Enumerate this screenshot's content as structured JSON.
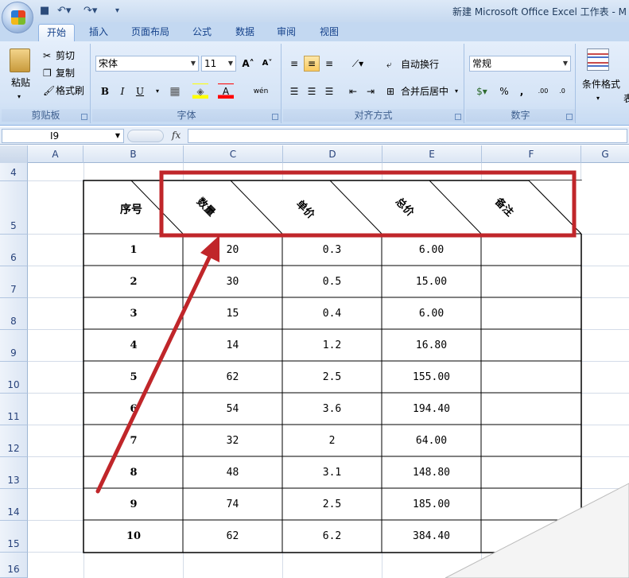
{
  "window": {
    "title": "新建 Microsoft Office Excel 工作表 - M"
  },
  "ribbon_tabs": [
    "开始",
    "插入",
    "页面布局",
    "公式",
    "数据",
    "审阅",
    "视图"
  ],
  "clipboard": {
    "paste": "粘贴",
    "cut": "剪切",
    "copy": "复制",
    "format_painter": "格式刷",
    "group": "剪贴板"
  },
  "font": {
    "name": "宋体",
    "size": "11",
    "grow": "A",
    "shrink": "A",
    "bold": "B",
    "italic": "I",
    "underline": "U",
    "color_letter": "A",
    "phonetic": "wén",
    "group": "字体"
  },
  "alignment": {
    "wrap": "自动换行",
    "merge": "合并后居中",
    "group": "对齐方式"
  },
  "number": {
    "format": "常规",
    "percent": "%",
    "comma": ",",
    "inc": ".00",
    "dec": ".0",
    "group": "数字"
  },
  "styles": {
    "cond": "条件格式",
    "more": "表"
  },
  "formula_bar": {
    "name_box": "I9",
    "fx": "fx",
    "value": ""
  },
  "columns": [
    "A",
    "B",
    "C",
    "D",
    "E",
    "F",
    "G"
  ],
  "rows": [
    "4",
    "5",
    "6",
    "7",
    "8",
    "9",
    "10",
    "11",
    "12",
    "13",
    "14",
    "15",
    "16"
  ],
  "table": {
    "headers": [
      "序号",
      "数量",
      "单价",
      "总价",
      "备注"
    ],
    "rows": [
      [
        "1",
        "20",
        "0.3",
        "6.00",
        ""
      ],
      [
        "2",
        "30",
        "0.5",
        "15.00",
        ""
      ],
      [
        "3",
        "15",
        "0.4",
        "6.00",
        ""
      ],
      [
        "4",
        "14",
        "1.2",
        "16.80",
        ""
      ],
      [
        "5",
        "62",
        "2.5",
        "155.00",
        ""
      ],
      [
        "6",
        "54",
        "3.6",
        "194.40",
        ""
      ],
      [
        "7",
        "32",
        "2",
        "64.00",
        ""
      ],
      [
        "8",
        "48",
        "3.1",
        "148.80",
        ""
      ],
      [
        "9",
        "74",
        "2.5",
        "185.00",
        ""
      ],
      [
        "10",
        "62",
        "6.2",
        "384.40",
        ""
      ]
    ]
  },
  "annotation": {
    "color": "#c0262a"
  }
}
